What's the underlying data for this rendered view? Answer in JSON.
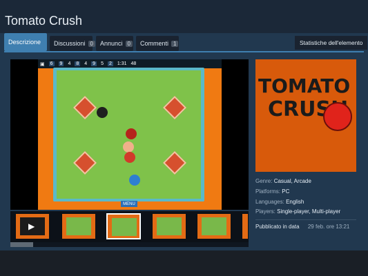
{
  "app": {
    "title": "Tomato Crush"
  },
  "tabs": [
    {
      "label": "Descrizione",
      "count": null
    },
    {
      "label": "Discussioni",
      "count": "0"
    },
    {
      "label": "Annunci",
      "count": "0"
    },
    {
      "label": "Commenti",
      "count": "1"
    }
  ],
  "stats_button": "Statistiche dell'elemento",
  "game_hud": {
    "p1": "6",
    "p2": "9",
    "p3": "4",
    "p4": "8",
    "p5": "4",
    "p6": "9",
    "p7": "5",
    "p8": "2",
    "time": "1:31",
    "score": "48"
  },
  "game_menu": "MENU",
  "capsule": {
    "logo_line1": "TOMATO",
    "logo_line2": "CRUSH"
  },
  "details": {
    "genre_label": "Genre:",
    "genre_value": "Casual, Arcade",
    "platforms_label": "Platforms:",
    "platforms_value": "PC",
    "languages_label": "Languages:",
    "languages_value": "English",
    "players_label": "Players:",
    "players_value": "Single-player, Multi-player"
  },
  "published": {
    "label": "Pubblicato in data",
    "date": "29 feb. ore 13:21"
  },
  "colors": {
    "accent": "#3f7fb0",
    "bg": "#1b2838",
    "panel": "#21384f"
  }
}
